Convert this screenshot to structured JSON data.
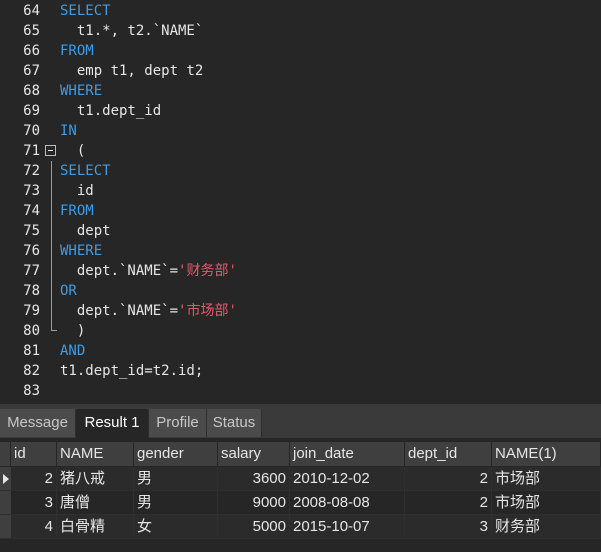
{
  "editor": {
    "lines": [
      {
        "num": "64",
        "tokens": [
          {
            "t": "kw",
            "v": "SELECT"
          }
        ]
      },
      {
        "num": "65",
        "tokens": [
          {
            "t": "plain",
            "v": "  t1.*, t2.`NAME`"
          }
        ]
      },
      {
        "num": "66",
        "tokens": [
          {
            "t": "kw",
            "v": "FROM"
          }
        ]
      },
      {
        "num": "67",
        "tokens": [
          {
            "t": "plain",
            "v": "  emp t1, dept t2"
          }
        ]
      },
      {
        "num": "68",
        "tokens": [
          {
            "t": "kw",
            "v": "WHERE"
          }
        ]
      },
      {
        "num": "69",
        "tokens": [
          {
            "t": "plain",
            "v": "  t1.dept_id"
          }
        ]
      },
      {
        "num": "70",
        "tokens": [
          {
            "t": "kw",
            "v": "IN"
          }
        ]
      },
      {
        "num": "71",
        "tokens": [
          {
            "t": "plain",
            "v": "  ("
          }
        ]
      },
      {
        "num": "72",
        "tokens": [
          {
            "t": "kw",
            "v": "SELECT"
          }
        ]
      },
      {
        "num": "73",
        "tokens": [
          {
            "t": "plain",
            "v": "  id"
          }
        ]
      },
      {
        "num": "74",
        "tokens": [
          {
            "t": "kw",
            "v": "FROM"
          }
        ]
      },
      {
        "num": "75",
        "tokens": [
          {
            "t": "plain",
            "v": "  dept"
          }
        ]
      },
      {
        "num": "76",
        "tokens": [
          {
            "t": "kw",
            "v": "WHERE"
          }
        ]
      },
      {
        "num": "77",
        "tokens": [
          {
            "t": "plain",
            "v": "  dept.`NAME`="
          },
          {
            "t": "str",
            "v": "'财务部'"
          }
        ]
      },
      {
        "num": "78",
        "tokens": [
          {
            "t": "kw",
            "v": "OR"
          }
        ]
      },
      {
        "num": "79",
        "tokens": [
          {
            "t": "plain",
            "v": "  dept.`NAME`="
          },
          {
            "t": "str",
            "v": "'市场部'"
          }
        ]
      },
      {
        "num": "80",
        "tokens": [
          {
            "t": "plain",
            "v": "  )"
          }
        ]
      },
      {
        "num": "81",
        "tokens": [
          {
            "t": "kw",
            "v": "AND"
          }
        ]
      },
      {
        "num": "82",
        "tokens": [
          {
            "t": "plain",
            "v": "t1.dept_id=t2.id;"
          }
        ]
      },
      {
        "num": "83",
        "tokens": []
      }
    ]
  },
  "tabs": [
    {
      "label": "Message",
      "active": false
    },
    {
      "label": "Result 1",
      "active": true
    },
    {
      "label": "Profile",
      "active": false
    },
    {
      "label": "Status",
      "active": false
    }
  ],
  "result": {
    "columns": [
      "id",
      "NAME",
      "gender",
      "salary",
      "join_date",
      "dept_id",
      "NAME(1)"
    ],
    "rows": [
      [
        "2",
        "猪八戒",
        "男",
        "3600",
        "2010-12-02",
        "2",
        "市场部"
      ],
      [
        "3",
        "唐僧",
        "男",
        "9000",
        "2008-08-08",
        "2",
        "市场部"
      ],
      [
        "4",
        "白骨精",
        "女",
        "5000",
        "2015-10-07",
        "3",
        "财务部"
      ]
    ]
  },
  "colors": {
    "keyword": "#3e9ce8",
    "string": "#e8586d",
    "text": "#e6e6e6",
    "background": "#262626"
  }
}
